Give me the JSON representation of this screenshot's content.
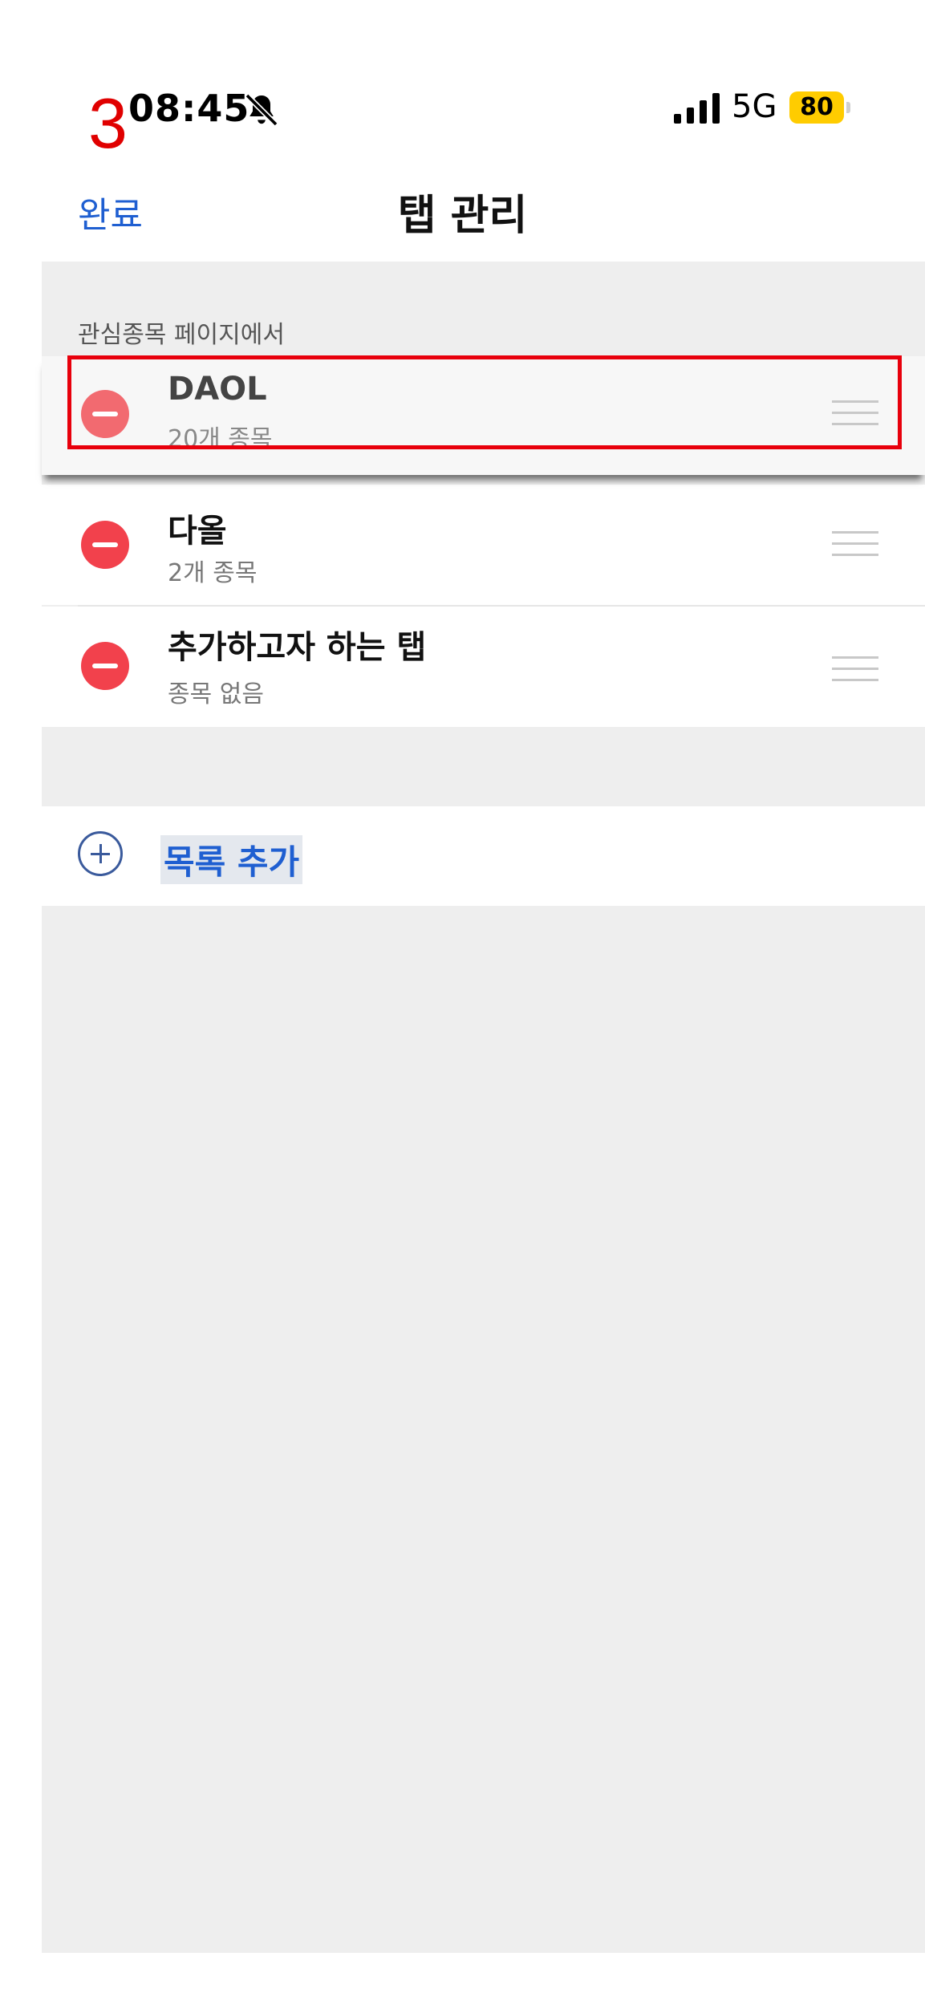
{
  "overlay": {
    "step_number": "3"
  },
  "status_bar": {
    "time": "08:45",
    "network": "5G",
    "battery": "80",
    "battery_color": "#ffcc00"
  },
  "header": {
    "done_label": "완료",
    "title": "탭 관리"
  },
  "section": {
    "label": "관심종목 페이지에서"
  },
  "tabs": [
    {
      "name": "DAOL",
      "subtitle": "20개 종목",
      "highlighted": true
    },
    {
      "name": "다올",
      "subtitle": "2개 종목"
    },
    {
      "name": "추가하고자 하는 탭",
      "subtitle": "종목 없음"
    }
  ],
  "add_list": {
    "label": "목록 추가"
  },
  "colors": {
    "accent": "#1f5fd1",
    "delete": "#f2414c",
    "highlight_box": "#e8000c",
    "panel_background": "#eeeeee"
  }
}
